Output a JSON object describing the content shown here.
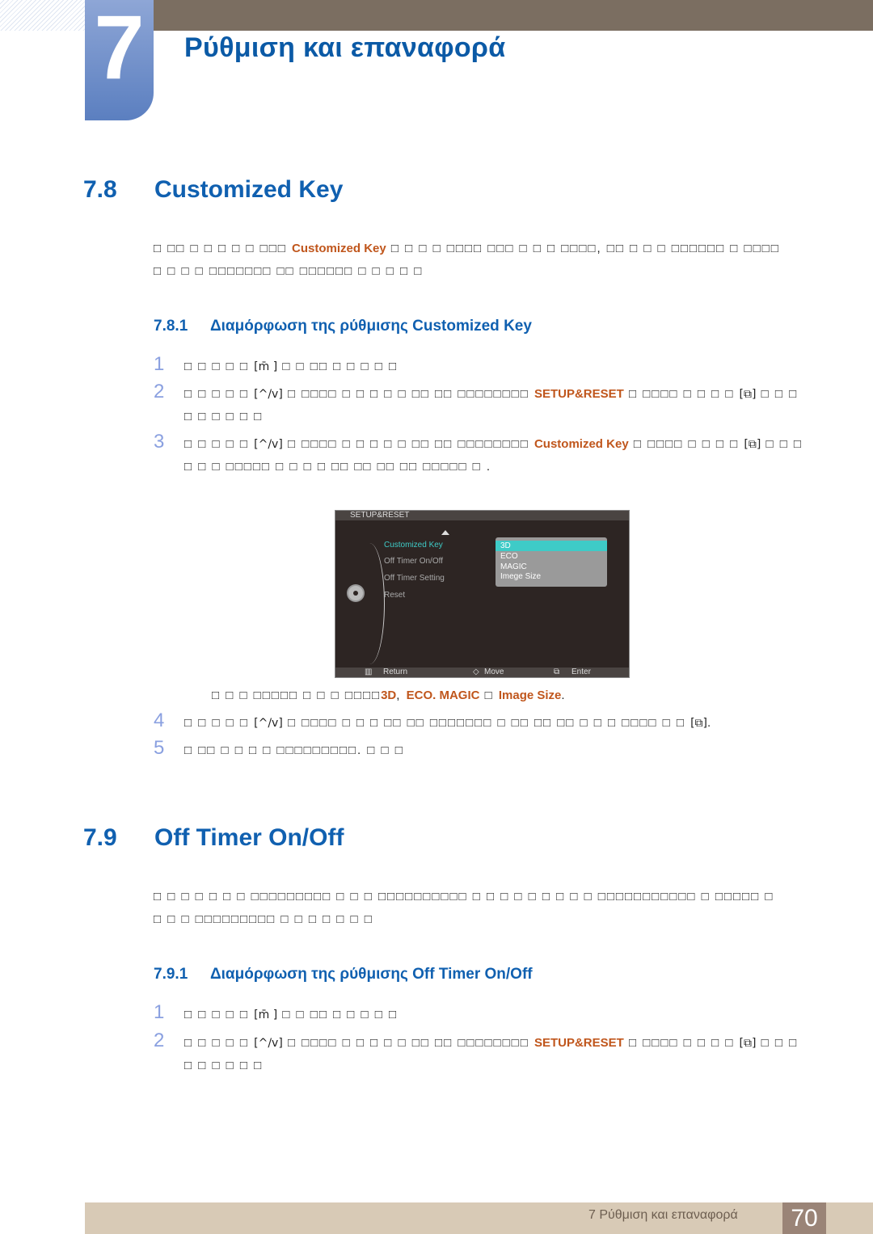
{
  "chapter": {
    "number": "7",
    "title": "Ρύθμιση και επαναφορά"
  },
  "sections": [
    {
      "number": "7.8",
      "title": "Customized Key",
      "intro": {
        "pre": "□ □□ □ □ □ □ □ □□□ ",
        "highlight": "Customized Key",
        "post": " □ □ □ □ □□□□ □□□ □ □ □ □□□□, □□ □ □ □ □□□□□□ □ □□□□",
        "line2": "□ □ □ □ □□□□□□□ □□ □□□□□□ □ □ □ □ □"
      },
      "subsection": {
        "number": "7.8.1",
        "title": "Διαμόρφωση της ρύθμισης Customized Key"
      },
      "steps": [
        {
          "n": "1",
          "pre": "□ □ □ □ □ ",
          "key": "[m̄ ]",
          "post": " □ □ □□ □ □ □ □ □"
        },
        {
          "n": "2",
          "pre": "□ □ □ □ □ ",
          "key": "[^/v]",
          "post": " □ □□□□ □ □ □ □ □ □□ □□ □□□□□□□□ ",
          "highlight": "SETUP&RESET",
          "post2": " □ □□□□ □ □ □ □ ",
          "key2": "[⧉]",
          "post3": " □ □ □",
          "line2": "□ □ □ □ □ □"
        },
        {
          "n": "3",
          "pre": "□ □ □ □ □ ",
          "key": "[^/v]",
          "post": " □ □□□□ □ □ □ □ □ □□ □□ □□□□□□□□ ",
          "highlight": "Customized Key",
          "post2": " □ □□□□ □ □ □ □ ",
          "key2": "[⧉]",
          "post3": " □ □ □",
          "line2": "□ □ □ □□□□□ □ □ □ □ □□ □□ □□ □□ □□□□□ □ ."
        }
      ],
      "osd": {
        "header": "SETUP&RESET",
        "menu": [
          "Customized Key",
          "Off Timer On/Off",
          "Off Timer Setting",
          "Reset"
        ],
        "active_index": 0,
        "options": [
          "3D",
          "ECO",
          "MAGIC",
          "Imege Size"
        ],
        "selected_option": "3D",
        "footer": {
          "return": "Return",
          "move": "Move",
          "enter": "Enter"
        }
      },
      "note": {
        "pre": "□ □ □ □□□□□ □ □ □ □□□□",
        "highlight1": "3D",
        "sep": ", ",
        "highlight2": "ECO. MAGIC",
        "mid": " □ ",
        "highlight3": "Image Size",
        "end": "."
      },
      "steps_after": [
        {
          "n": "4",
          "pre": "□ □ □ □ □ ",
          "key": "[^/v]",
          "post": " □ □□□□ □ □ □ □□ □□ □□□□□□□ □ □□ □□ □□ □ □ □ □□□□ □ □ ",
          "key2": "[⧉]",
          "post3": "."
        },
        {
          "n": "5",
          "text": "□ □□ □ □ □ □ □□□□□□□□□. □ □ □"
        }
      ]
    },
    {
      "number": "7.9",
      "title": "Off Timer On/Off",
      "intro": {
        "line1": "□ □ □ □ □ □ □ □□□□□□□□□ □ □ □ □□□□□□□□□□ □ □ □ □ □ □ □ □ □ □□□□□□□□□□□ □ □□□□□ □",
        "line2": "□ □ □ □□□□□□□□□ □ □ □ □ □ □ □"
      },
      "subsection": {
        "number": "7.9.1",
        "title": "Διαμόρφωση της ρύθμισης Off Timer On/Off"
      },
      "steps": [
        {
          "n": "1",
          "pre": "□ □ □ □ □ ",
          "key": "[m̄ ]",
          "post": " □ □ □□ □ □ □ □ □"
        },
        {
          "n": "2",
          "pre": "□ □ □ □ □ ",
          "key": "[^/v]",
          "post": " □ □□□□ □ □ □ □ □ □□ □□ □□□□□□□□ ",
          "highlight": "SETUP&RESET",
          "post2": " □ □□□□ □ □ □ □ ",
          "key2": "[⧉]",
          "post3": " □ □ □",
          "line2": "□ □ □ □ □ □"
        }
      ]
    }
  ],
  "footer": {
    "text": "7 Ρύθμιση και επαναφορά",
    "page": "70"
  }
}
